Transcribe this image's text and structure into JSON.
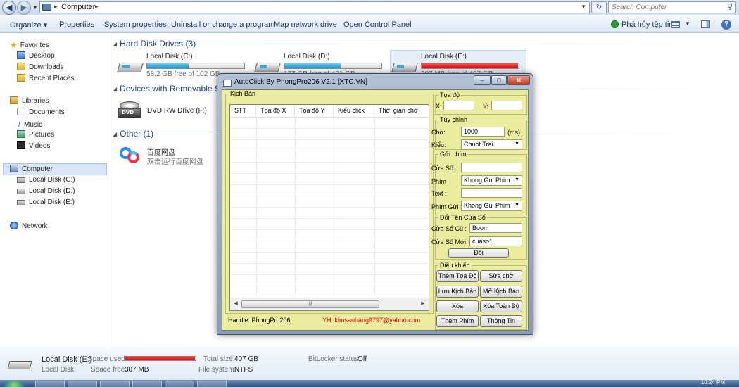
{
  "address_bar": {
    "path_item": "Computer",
    "search_placeholder": "Search Computer"
  },
  "command_bar": {
    "organize": "Organize ▾",
    "properties": "Properties",
    "system_properties": "System properties",
    "uninstall": "Uninstall or change a program",
    "map_drive": "Map network drive",
    "control_panel": "Open Control Panel",
    "fix_label": "Phá hủy tệp tin"
  },
  "sidebar": {
    "favorites": "Favorites",
    "desktop": "Desktop",
    "downloads": "Downloads",
    "recent_places": "Recent Places",
    "libraries": "Libraries",
    "documents": "Documents",
    "music": "Music",
    "pictures": "Pictures",
    "videos": "Videos",
    "computer": "Computer",
    "disk_c": "Local Disk (C:)",
    "disk_d": "Local Disk (D:)",
    "disk_e": "Local Disk (E:)",
    "network": "Network"
  },
  "main": {
    "hdd_header": "Hard Disk Drives (3)",
    "removable_header": "Devices with Removable Storage (1)",
    "other_header": "Other (1)",
    "drives": [
      {
        "name": "Local Disk (C:)",
        "free": "58.2 GB free of 102 GB",
        "used_fraction": 0.43
      },
      {
        "name": "Local Disk (D:)",
        "free": "177 GB free of 421 GB",
        "used_fraction": 0.58
      },
      {
        "name": "Local Disk (E:)",
        "free": "307 MB free of 407 GB",
        "used_fraction": 0.99
      }
    ],
    "dvd_name": "DVD RW Drive (F:)",
    "dvd_tag": "DVD",
    "other_name": "百度网盘",
    "other_desc": "双击运行百度网盘"
  },
  "details": {
    "name": "Local Disk (E:)",
    "type": "Local Disk",
    "space_used_label": "Space used:",
    "used_fraction": 0.99,
    "space_free_label": "Space free:",
    "space_free_value": "307 MB",
    "total_size_label": "Total size:",
    "total_size_value": "407 GB",
    "fs_label": "File system:",
    "fs_value": "NTFS",
    "bitlocker_label": "BitLocker status:",
    "bitlocker_value": "Off"
  },
  "taskbar": {
    "clock": "10:24 PM"
  },
  "autoclick": {
    "title": "AutoClick By PhongPro206 V2.1 [XTC.VN]",
    "script_group": "Kịch Bản",
    "columns": [
      "STT",
      "Tọa độ X",
      "Tọa độ Y",
      "Kiểu click",
      "Thời gian chờ"
    ],
    "coord_group": "Tọa độ",
    "x_label": "X:",
    "y_label": "Y:",
    "custom_group": "Tùy chỉnh",
    "wait_label": "Chờ:",
    "wait_value": "1000",
    "wait_unit": "(ms)",
    "type_label": "Kiểu:",
    "type_value": "Chuot Trai",
    "send_group": "Gửi phím",
    "window_label": "Cửa Sổ :",
    "key_label": "Phím",
    "key_value": "Khong Gui Phim",
    "text_label": "Text :",
    "send_key_label": "Phím Gửi :",
    "send_key_value": "Khong Gui Phim",
    "rename_group": "Đổi Tên Cửa Sổ",
    "old_window_label": "Cửa Sổ Cũ :",
    "old_window_value": "Boom",
    "new_window_label": "Cửa Sổ Mới",
    "new_window_value": "cuaso1",
    "rename_button": "Đổi",
    "control_group": "Điều khiển",
    "buttons": {
      "add_coord": "Thêm Tọa Độ",
      "edit_wait": "Sửa chờ",
      "save_script": "Lưu Kịch Bản",
      "open_script": "Mở Kịch Bản",
      "delete": "Xóa",
      "delete_all": "Xóa Toàn Bộ",
      "add_key": "Thêm Phím",
      "info": "Thông Tin"
    },
    "handle_text": "Handle: PhongPro206",
    "email_text": "YH: kimsaobang9797@yahoo.com",
    "colors": {
      "client_bg": "#ecec9f",
      "email": "#e00000"
    }
  }
}
